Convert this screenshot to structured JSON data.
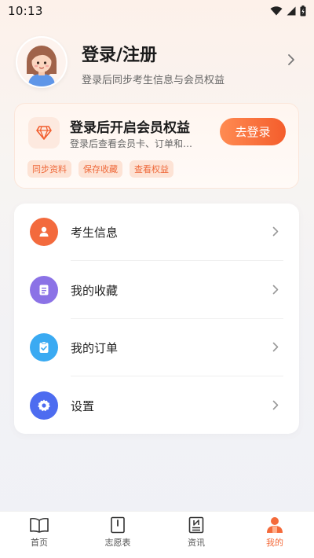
{
  "status_bar": {
    "time": "10:13"
  },
  "profile": {
    "title": "登录/注册",
    "subtitle": "登录后同步考生信息与会员权益"
  },
  "vip": {
    "title": "登录后开启会员权益",
    "subtitle": "登录后查看会员卡、订单和…",
    "login_button": "去登录",
    "tags": [
      "同步资料",
      "保存收藏",
      "查看权益"
    ]
  },
  "menu": {
    "items": [
      {
        "label": "考生信息",
        "icon": "user-icon",
        "color": "#f36a3d"
      },
      {
        "label": "我的收藏",
        "icon": "note-icon",
        "color": "#8b72e6"
      },
      {
        "label": "我的订单",
        "icon": "clipboard-check-icon",
        "color": "#3aaaf2"
      },
      {
        "label": "设置",
        "icon": "gear-icon",
        "color": "#4d6cf0"
      }
    ]
  },
  "tabbar": {
    "tabs": [
      {
        "label": "首页",
        "icon": "book-icon",
        "active": false
      },
      {
        "label": "志愿表",
        "icon": "form-icon",
        "active": false
      },
      {
        "label": "资讯",
        "icon": "news-icon",
        "active": false
      },
      {
        "label": "我的",
        "icon": "person-icon",
        "active": true
      }
    ]
  },
  "colors": {
    "accent": "#f46a3a",
    "tag_bg": "#fde3d5",
    "page_bg": "#f2f2f5"
  }
}
